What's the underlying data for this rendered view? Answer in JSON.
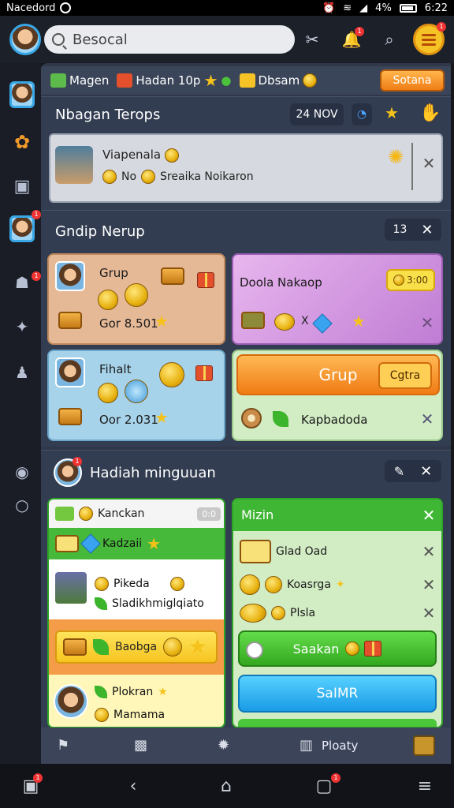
{
  "status": {
    "carrier": "Nacedord",
    "battery": "4%",
    "time": "6:22"
  },
  "topbar": {
    "search_placeholder": "Besocal"
  },
  "toolbar": {
    "items": [
      "Magen",
      "Hadan 10p",
      "Dbsam"
    ],
    "button": "Sotana"
  },
  "section1": {
    "title": "Nbagan Terops",
    "date": "24 NOV",
    "notif_name": "Viapenala",
    "notif_sub_left": "No",
    "notif_sub_right": "Sreaika Noikaron"
  },
  "section2": {
    "title": "Gndip Nerup",
    "count": "13",
    "card1": {
      "title": "Grup",
      "value": "Gor 8.501"
    },
    "card2": {
      "title": "Doola Nakaop",
      "badge": "3:00"
    },
    "card3": {
      "title": "Fihalt",
      "value": "Oor 2.031"
    },
    "card4": {
      "button": "Grup",
      "mini": "Cgtra",
      "label": "Kapbadoda"
    }
  },
  "section3": {
    "title": "Hadiah minguuan",
    "left": {
      "row1": "Kanckan",
      "row1_badge": "0:0",
      "row2": "Kadzaii",
      "row3": "Pikeda",
      "row4": "Sladikhmiglqiato",
      "btn": "Baobga",
      "row5": "Plokran",
      "row6": "Mamama"
    },
    "right": {
      "header": "Mizin",
      "row1": "Glad Oad",
      "row2": "Koasrga",
      "row3": "Plsla",
      "green": "Saakan",
      "blue": "SaIMR"
    }
  },
  "bottom": {
    "label": "Ploaty"
  }
}
